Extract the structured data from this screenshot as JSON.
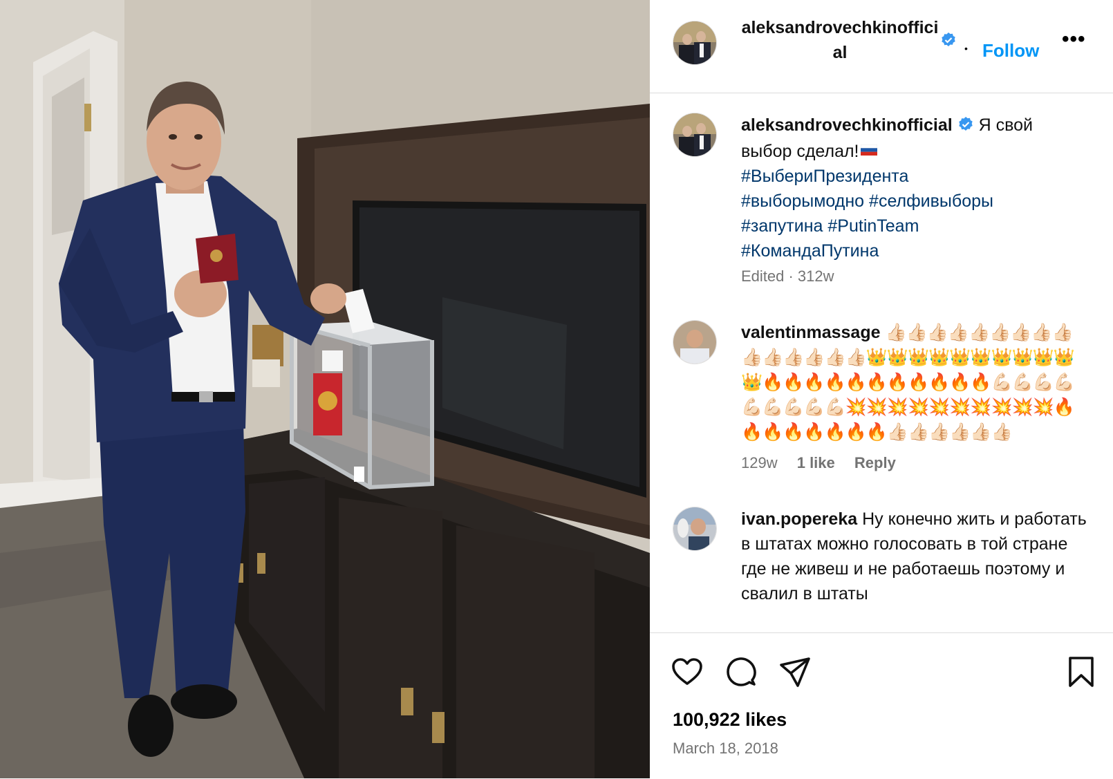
{
  "post": {
    "username": "aleksandrovechkinofficial",
    "follow_label": "Follow",
    "dot": "•",
    "more_label": "•••"
  },
  "caption": {
    "username": "aleksandrovechkinofficial",
    "text": "Я свой выбор сделал!",
    "hashtags": [
      "#ВыбериПрезидента",
      "#выборымодно",
      "#селфивыборы",
      "#запутина",
      "#PutinTeam",
      "#КомандаПутина"
    ],
    "meta": "Edited · 312w"
  },
  "comments": [
    {
      "username": "valentinmassage",
      "text": "👍🏻👍🏻👍🏻👍🏻👍🏻👍🏻👍🏻👍🏻👍🏻👍🏻👍🏻👍🏻👍🏻👍🏻👍🏻👑👑👑👑👑👑👑👑👑👑👑🔥🔥🔥🔥🔥🔥🔥🔥🔥🔥🔥💪🏻💪🏻💪🏻💪🏻💪🏻💪🏻💪🏻💪🏻💪🏻💥💥💥💥💥💥💥💥💥💥🔥🔥🔥🔥🔥🔥🔥🔥👍🏻👍🏻👍🏻👍🏻👍🏻👍🏻",
      "age": "129w",
      "likes": "1 like",
      "reply": "Reply"
    },
    {
      "username": "ivan.popereka",
      "text": "Ну конечно жить и работать в штатах можно голосовать в той стране где не живеш и не работаешь поэтому и свалил в штаты"
    }
  ],
  "footer": {
    "likes": "100,922 likes",
    "date": "March 18, 2018"
  },
  "icons": {
    "verified": "verified-badge-icon",
    "like": "heart-icon",
    "comment": "comment-bubble-icon",
    "share": "paper-plane-icon",
    "save": "bookmark-icon"
  },
  "colors": {
    "link": "#0095f6",
    "hashtag": "#00376b",
    "muted": "#737373",
    "verified": "#3897f0"
  }
}
